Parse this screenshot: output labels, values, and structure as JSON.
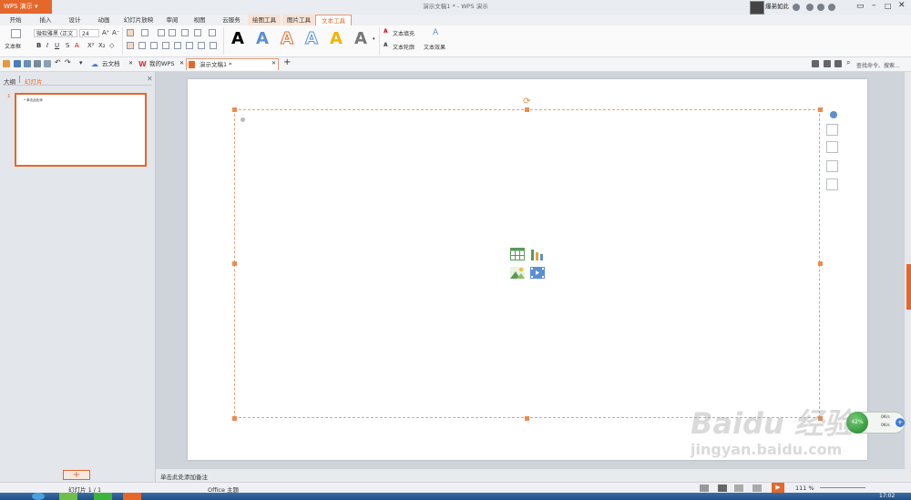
{
  "window": {
    "app_button": "WPS 演示",
    "doc_title": "演示文稿1 * - WPS 演示",
    "user_name": "爆弟如此"
  },
  "ribbon_tabs": [
    "开始",
    "插入",
    "设计",
    "动画",
    "幻灯片放映",
    "审阅",
    "视图",
    "云服务",
    "绘图工具",
    "图片工具",
    "文本工具"
  ],
  "ribbon": {
    "textbox_label": "文本框",
    "font_name": "微软雅黑 (正文",
    "font_size": "24",
    "text_fill_label": "文本填充",
    "text_outline_label": "文本轮廓",
    "text_effect_label": "文本效果",
    "style_letters": [
      "A",
      "A",
      "A",
      "A",
      "A",
      "A"
    ]
  },
  "quick_toolbar": {
    "doc_tabs": [
      "云文档",
      "我的WPS",
      "演示文稿1 *"
    ],
    "search_placeholder": "查找命令、搜索..."
  },
  "left_pane": {
    "tab_outline": "大纲",
    "tab_slides": "幻灯片",
    "slide_number": "1",
    "thumb_text": "• 单击此处添"
  },
  "notes_placeholder": "单击此处添加备注",
  "status": {
    "slide_counter": "幻灯片 1 / 1",
    "theme": "Office 主题",
    "zoom": "111 %"
  },
  "net_widget": {
    "percent": "42%",
    "up": "0K/s",
    "down": "0K/s"
  },
  "watermark": "Baidu 经验",
  "watermark_sub": "jingyan.baidu.com",
  "taskbar_time": "17:02"
}
